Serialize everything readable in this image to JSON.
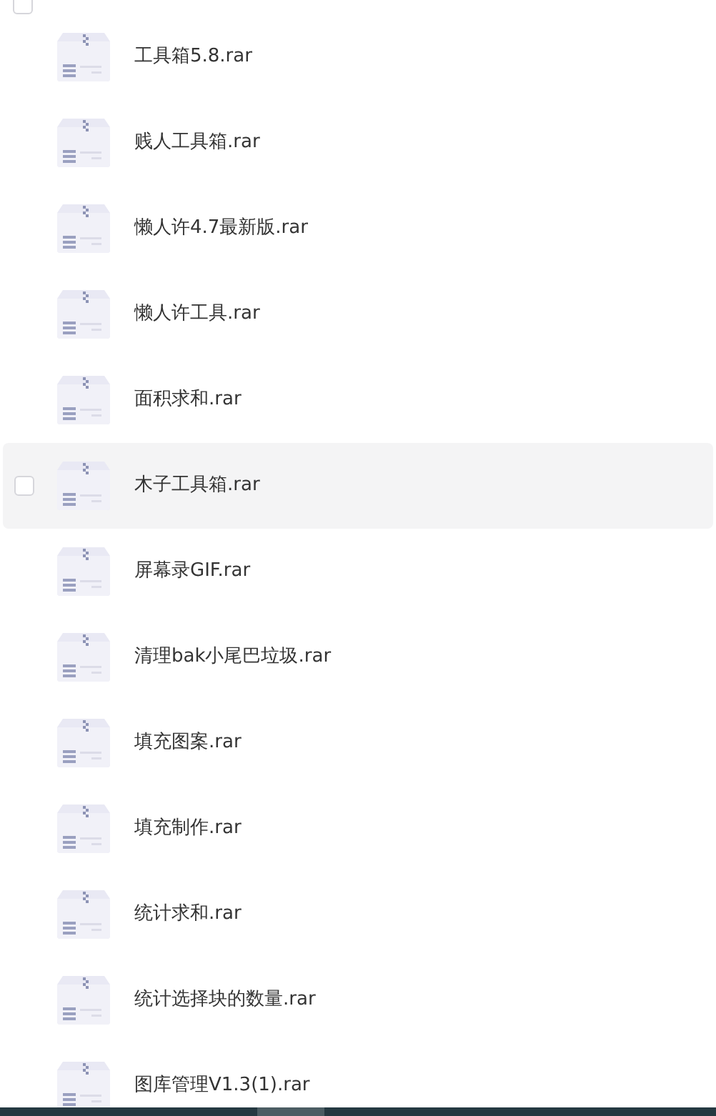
{
  "header": {
    "checked": false
  },
  "files": [
    {
      "name": "工具箱5.8.rar",
      "selected": false,
      "checked": false
    },
    {
      "name": "贱人工具箱.rar",
      "selected": false,
      "checked": false
    },
    {
      "name": "懒人许4.7最新版.rar",
      "selected": false,
      "checked": false
    },
    {
      "name": "懒人许工具.rar",
      "selected": false,
      "checked": false
    },
    {
      "name": "面积求和.rar",
      "selected": false,
      "checked": false
    },
    {
      "name": "木子工具箱.rar",
      "selected": true,
      "checked": false
    },
    {
      "name": "屏幕录GIF.rar",
      "selected": false,
      "checked": false
    },
    {
      "name": "清理bak小尾巴垃圾.rar",
      "selected": false,
      "checked": false
    },
    {
      "name": "填充图案.rar",
      "selected": false,
      "checked": false
    },
    {
      "name": "填充制作.rar",
      "selected": false,
      "checked": false
    },
    {
      "name": "统计求和.rar",
      "selected": false,
      "checked": false
    },
    {
      "name": "统计选择块的数量.rar",
      "selected": false,
      "checked": false
    },
    {
      "name": "图库管理V1.3(1).rar",
      "selected": false,
      "checked": false
    }
  ]
}
